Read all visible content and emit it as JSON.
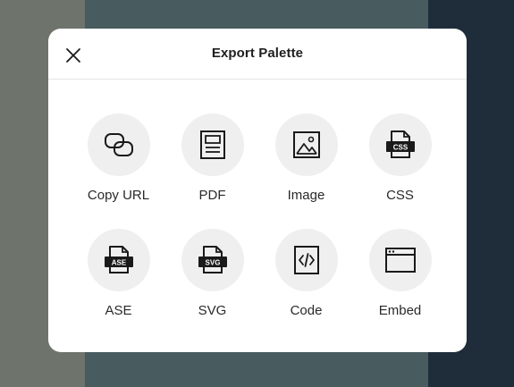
{
  "dialog": {
    "title": "Export Palette",
    "close_icon": "close-icon"
  },
  "options": [
    {
      "label": "Copy URL",
      "icon": "link-icon"
    },
    {
      "label": "PDF",
      "icon": "pdf-document-icon"
    },
    {
      "label": "Image",
      "icon": "image-icon"
    },
    {
      "label": "CSS",
      "icon": "css-file-icon",
      "badge": "CSS"
    },
    {
      "label": "ASE",
      "icon": "ase-file-icon",
      "badge": "ASE"
    },
    {
      "label": "SVG",
      "icon": "svg-file-icon",
      "badge": "SVG"
    },
    {
      "label": "Code",
      "icon": "code-file-icon"
    },
    {
      "label": "Embed",
      "icon": "embed-window-icon"
    }
  ],
  "colors": {
    "icon_stroke": "#1a1a1a",
    "circle_bg": "#efefef",
    "modal_bg": "#ffffff"
  }
}
